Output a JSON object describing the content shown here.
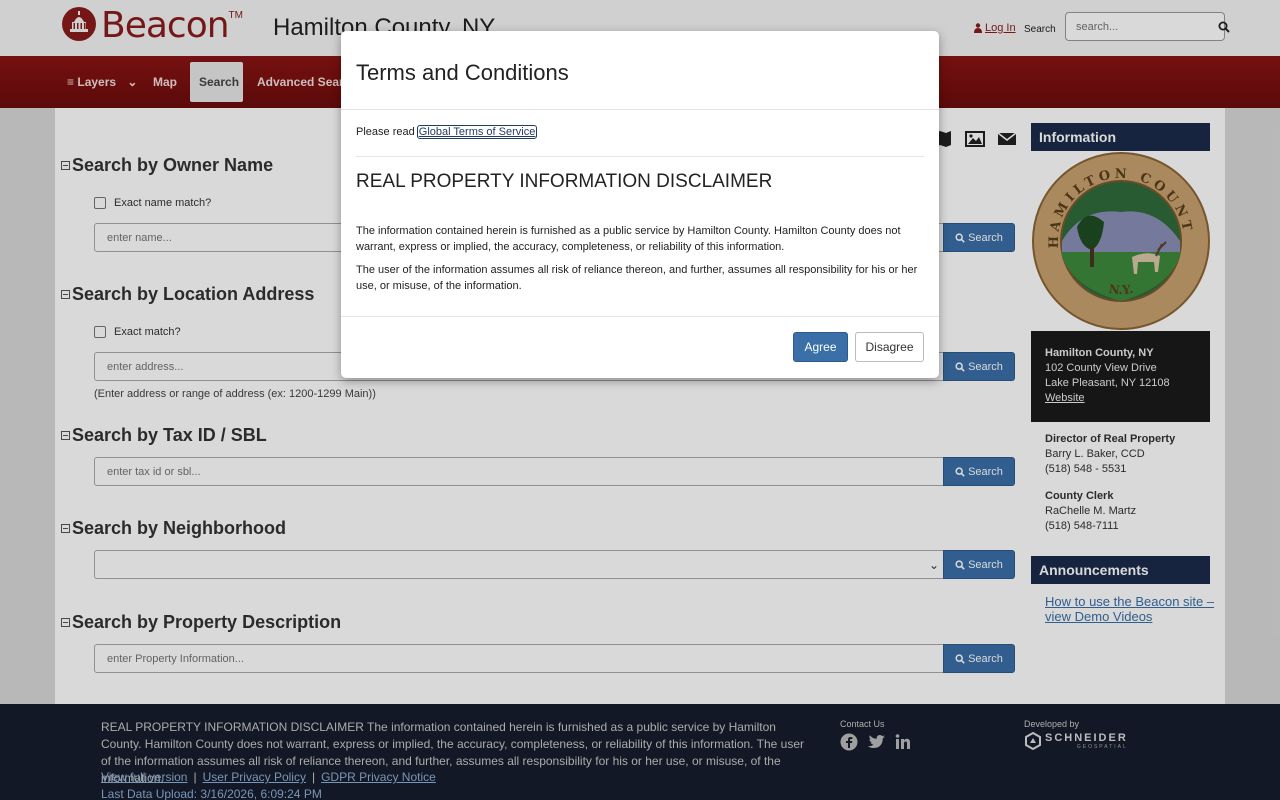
{
  "header": {
    "brand": "Beacon",
    "tm": "TM",
    "county": "Hamilton County, NY",
    "login": "Log In",
    "search_label": "Search",
    "search_placeholder": "search..."
  },
  "nav": {
    "layers": "Layers",
    "map": "Map",
    "search": "Search",
    "advanced": "Advanced Search"
  },
  "sections": {
    "owner": {
      "title": "Search by Owner Name",
      "checkbox": "Exact name match?",
      "placeholder": "enter name...",
      "button": "Search"
    },
    "location": {
      "title": "Search by Location Address",
      "checkbox": "Exact match?",
      "placeholder": "enter address...",
      "hint": "(Enter address or range of address (ex: 1200-1299 Main))",
      "button": "Search"
    },
    "taxid": {
      "title": "Search by Tax ID / SBL",
      "placeholder": "enter tax id or sbl...",
      "button": "Search"
    },
    "neighborhood": {
      "title": "Search by Neighborhood",
      "button": "Search"
    },
    "property": {
      "title": "Search by Property Description",
      "placeholder": "enter Property Information...",
      "button": "Search"
    }
  },
  "info": {
    "heading": "Information",
    "seal_text_top": "HAMILTON COUNTY",
    "seal_text_bottom": "N.Y.",
    "address": {
      "name": "Hamilton County, NY",
      "line1": "102 County View Drive",
      "line2": "Lake Pleasant, NY 12108",
      "website": "Website"
    },
    "director": {
      "title": "Director of Real Property",
      "name": "Barry L. Baker, CCD",
      "phone": "(518) 548 - 5531"
    },
    "clerk": {
      "title": "County Clerk",
      "name": "RaChelle M. Martz",
      "phone": "(518) 548-7111"
    },
    "announcements_heading": "Announcements",
    "announcement_link": "How to use the Beacon site – view Demo Videos"
  },
  "footer": {
    "disclaimer": "REAL PROPERTY INFORMATION DISCLAIMER The information contained herein is furnished as a public service by Hamilton County. Hamilton County does not warrant, express or implied, the accuracy, completeness, or reliability of this information. The user of the information assumes all risk of reliance thereon, and further, assumes all responsibility for his or her use, or misuse, of the information.",
    "links": [
      "View full version",
      "User Privacy Policy",
      "GDPR Privacy Notice"
    ],
    "upload": "Last Data Upload: 3/16/2026, 6:09:24 PM",
    "contact_us": "Contact Us",
    "developed_by": "Developed by",
    "developer": "SCHNEIDER",
    "developer_sub": "GEOSPATIAL"
  },
  "modal": {
    "title": "Terms and Conditions",
    "please_read": "Please read",
    "terms_link": "Global Terms of Service",
    "disclaimer_title": "REAL PROPERTY INFORMATION DISCLAIMER",
    "p1": "The information contained herein is furnished as a public service by Hamilton County. Hamilton County does not warrant, express or implied, the accuracy, completeness, or reliability of this information.",
    "p2": "The user of the information assumes all risk of reliance thereon, and further, assumes all responsibility for his or her use, or misuse, of the information.",
    "agree": "Agree",
    "disagree": "Disagree"
  },
  "colors": {
    "brand_red": "#8a1c1c",
    "nav_red": "#7d0f0f",
    "button_blue": "#3a6fa8",
    "panel_navy": "#1c2b4a",
    "footer_bg": "#161d2c"
  }
}
